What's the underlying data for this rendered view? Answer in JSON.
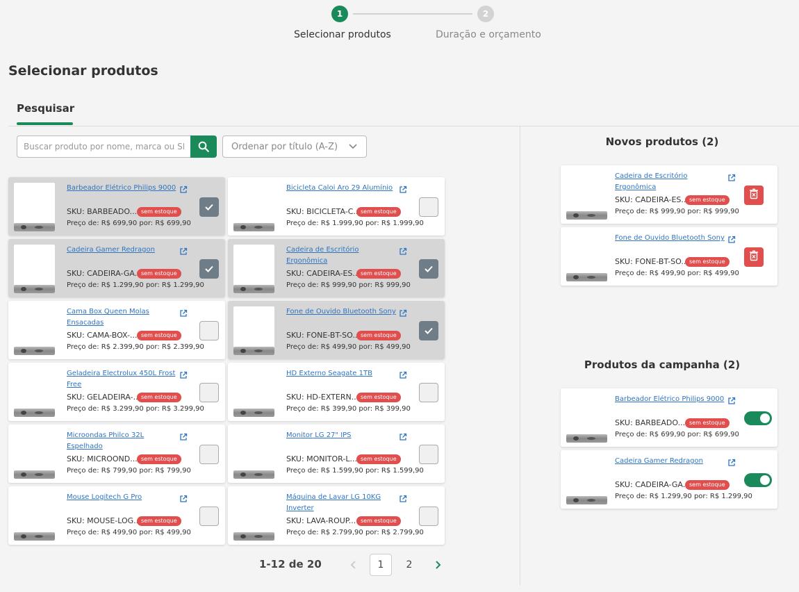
{
  "stepper": {
    "steps": [
      {
        "number": "1",
        "label": "Selecionar produtos"
      },
      {
        "number": "2",
        "label": "Duração e orçamento"
      }
    ]
  },
  "page_title": "Selecionar produtos",
  "tab": {
    "label": "Pesquisar"
  },
  "search": {
    "placeholder": "Buscar produto por nome, marca ou SKU"
  },
  "sort": {
    "label": "Ordenar por título (A-Z)"
  },
  "colors": {
    "accent": "#1b8a5a",
    "badge": "#e04e4e",
    "link": "#2f74c0",
    "checked": "#6e7d87"
  },
  "products": [
    {
      "name": "Barbeador Elétrico Philips 9000",
      "sku": "SKU: BARBEADO...",
      "badge": "sem estoque",
      "price": "Preço de: R$ 699,90 por: R$ 699,90",
      "selected": true
    },
    {
      "name": "Bicicleta Caloi Aro 29 Alumínio",
      "sku": "SKU: BICICLETA-C...",
      "badge": "sem estoque",
      "price": "Preço de: R$ 1.999,90 por: R$ 1.999,90",
      "selected": false
    },
    {
      "name": "Cadeira Gamer Redragon",
      "sku": "SKU: CADEIRA-GA...",
      "badge": "sem estoque",
      "price": "Preço de: R$ 1.299,90 por: R$ 1.299,90",
      "selected": true
    },
    {
      "name": "Cadeira de Escritório Ergonômica",
      "sku": "SKU: CADEIRA-ES...",
      "badge": "sem estoque",
      "price": "Preço de: R$ 999,90 por: R$ 999,90",
      "selected": true
    },
    {
      "name": "Cama Box Queen Molas Ensacadas",
      "sku": "SKU: CAMA-BOX-...",
      "badge": "sem estoque",
      "price": "Preço de: R$ 2.399,90 por: R$ 2.399,90",
      "selected": false
    },
    {
      "name": "Fone de Ouvido Bluetooth Sony",
      "sku": "SKU: FONE-BT-SO...",
      "badge": "sem estoque",
      "price": "Preço de: R$ 499,90 por: R$ 499,90",
      "selected": true
    },
    {
      "name": "Geladeira Electrolux 450L Frost Free",
      "sku": "SKU: GELADEIRA-...",
      "badge": "sem estoque",
      "price": "Preço de: R$ 3.299,90 por: R$ 3.299,90",
      "selected": false
    },
    {
      "name": "HD Externo Seagate 1TB",
      "sku": "SKU: HD-EXTERN...",
      "badge": "sem estoque",
      "price": "Preço de: R$ 399,90 por: R$ 399,90",
      "selected": false
    },
    {
      "name": "Microondas Philco 32L Espelhado",
      "sku": "SKU: MICROOND...",
      "badge": "sem estoque",
      "price": "Preço de: R$ 799,90 por: R$ 799,90",
      "selected": false
    },
    {
      "name": "Monitor LG 27\" IPS",
      "sku": "SKU: MONITOR-L...",
      "badge": "sem estoque",
      "price": "Preço de: R$ 1.599,90 por: R$ 1.599,90",
      "selected": false
    },
    {
      "name": "Mouse Logitech G Pro",
      "sku": "SKU: MOUSE-LOG...",
      "badge": "sem estoque",
      "price": "Preço de: R$ 499,90 por: R$ 499,90",
      "selected": false
    },
    {
      "name": "Máquina de Lavar LG 10KG Inverter",
      "sku": "SKU: LAVA-ROUP...",
      "badge": "sem estoque",
      "price": "Preço de: R$ 2.799,90 por: R$ 2.799,90",
      "selected": false
    }
  ],
  "pagination": {
    "count": "1-12 de 20",
    "pages": [
      "1",
      "2"
    ],
    "current": "1"
  },
  "new_products": {
    "title": "Novos produtos (2)",
    "items": [
      {
        "name": "Cadeira de Escritório Ergonômica",
        "sku": "SKU: CADEIRA-ES...",
        "badge": "sem estoque",
        "price": "Preço de: R$ 999,90 por: R$ 999,90"
      },
      {
        "name": "Fone de Ouvido Bluetooth Sony",
        "sku": "SKU: FONE-BT-SO...",
        "badge": "sem estoque",
        "price": "Preço de: R$ 499,90 por: R$ 499,90"
      }
    ]
  },
  "campaign_products": {
    "title": "Produtos da campanha (2)",
    "items": [
      {
        "name": "Barbeador Elétrico Philips 9000",
        "sku": "SKU: BARBEADO...",
        "badge": "sem estoque",
        "price": "Preço de: R$ 699,90 por: R$ 699,90",
        "active": true
      },
      {
        "name": "Cadeira Gamer Redragon",
        "sku": "SKU: CADEIRA-GA...",
        "badge": "sem estoque",
        "price": "Preço de: R$ 1.299,90 por: R$ 1.299,90",
        "active": true
      }
    ]
  }
}
